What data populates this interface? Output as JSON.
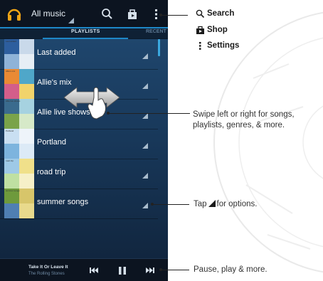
{
  "app": {
    "title": "All music"
  },
  "tabs": {
    "active": "PLAYLISTS",
    "next": "RECENT"
  },
  "playlists": [
    {
      "label": "Last added",
      "art": [
        "#2d5e9e",
        "#c9d9ea",
        "#8fb3d8",
        "#e6eef5"
      ],
      "caption": "Last added"
    },
    {
      "label": "Allie's mix",
      "art": [
        "#e98a34",
        "#4fa7c9",
        "#d35e8a",
        "#f1d36b"
      ],
      "caption": "Allie's mix"
    },
    {
      "label": "Allie live shows",
      "art": [
        "#3a6b8e",
        "#a6d2e0",
        "#7aa34a",
        "#d6e9c8"
      ],
      "caption": "Allie live shows"
    },
    {
      "label": "Portland",
      "art": [
        "#c9dff2",
        "#eef4fa",
        "#7db4de",
        "#dceaf6"
      ],
      "caption": "Portland"
    },
    {
      "label": "road trip",
      "art": [
        "#9ec9e6",
        "#f0e08a",
        "#bfe0a2",
        "#f6f0c8"
      ],
      "caption": "road trip"
    },
    {
      "label": "summer songs",
      "art": [
        "#6e9a3c",
        "#d7c56a",
        "#4f7fb3",
        "#e8d98c"
      ],
      "caption": "summer songs"
    }
  ],
  "now_playing": {
    "title": "Take It Or Leave It",
    "artist": "The Rolling Stones"
  },
  "menu_callouts": {
    "search": "Search",
    "shop": "Shop",
    "settings": "Settings"
  },
  "notes": {
    "swipe": "Swipe left or right for songs, playlists, genres, & more.",
    "options_before": "Tap",
    "options_after": "for options.",
    "playback": "Pause, play & more."
  },
  "colors": {
    "accent": "#1e88c8",
    "list_bg": "#1f466d",
    "topbar_bg": "#0c1420"
  },
  "icons": [
    "headphones-icon",
    "search-icon",
    "shop-icon",
    "overflow-menu-icon",
    "previous-icon",
    "pause-icon",
    "next-icon",
    "option-triangle-icon",
    "swipe-hand-icon"
  ]
}
